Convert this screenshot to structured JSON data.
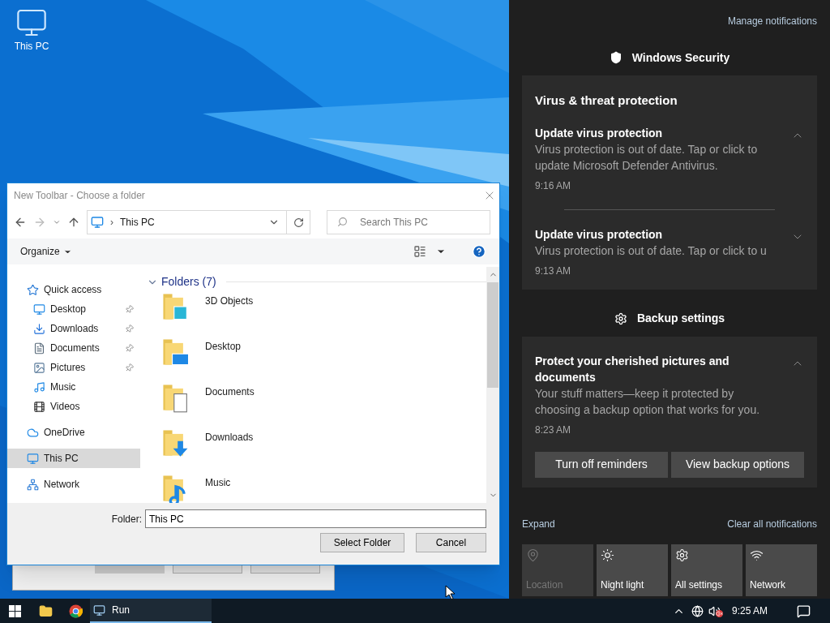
{
  "desktop": {
    "icons": [
      {
        "label": "This PC"
      }
    ]
  },
  "run_dialog": {
    "buttons": [
      {
        "disabled": true
      },
      {
        "disabled": false
      },
      {
        "disabled": false
      }
    ]
  },
  "dialog": {
    "title": "New Toolbar - Choose a folder",
    "address_separator": "›",
    "address": "This PC",
    "search": {
      "placeholder": "Search This PC"
    },
    "organize": "Organize",
    "nav": [
      {
        "label": "Quick access",
        "selected": false,
        "children": [
          {
            "label": "Desktop",
            "pinned": true,
            "selected": false
          },
          {
            "label": "Downloads",
            "pinned": true,
            "selected": false
          },
          {
            "label": "Documents",
            "pinned": true,
            "selected": false
          },
          {
            "label": "Pictures",
            "pinned": true,
            "selected": false
          },
          {
            "label": "Music",
            "pinned": false,
            "selected": false
          },
          {
            "label": "Videos",
            "pinned": false,
            "selected": false
          }
        ]
      },
      {
        "label": "OneDrive",
        "selected": false
      },
      {
        "label": "This PC",
        "selected": true
      },
      {
        "label": "Network",
        "selected": false
      }
    ],
    "group": {
      "label": "Folders (7)",
      "expanded": true
    },
    "folders": [
      "3D Objects",
      "Desktop",
      "Documents",
      "Downloads",
      "Music"
    ],
    "folder_label": "Folder:",
    "folder_value": "This PC",
    "buttons": [
      "Select Folder",
      "Cancel"
    ]
  },
  "action_center": {
    "manage": "Manage notifications",
    "groups": [
      {
        "app": "Windows Security",
        "kind": "security",
        "title": "Virus & threat protection",
        "notifications": [
          {
            "title": "Update virus protection",
            "body": "Virus protection is out of date. Tap or click to update Microsoft Defender Antivirus.",
            "time": "9:16 AM",
            "expanded": true
          },
          {
            "title": "Update virus protection",
            "body": "Virus protection is out of date. Tap or click to u",
            "time": "9:13 AM",
            "expanded": false
          }
        ]
      },
      {
        "app": "Backup settings",
        "kind": "settings",
        "notifications": [
          {
            "title": "Protect your cherished pictures and documents",
            "body": "Your stuff matters—keep it protected by choosing a backup option that works for you.",
            "time": "8:23 AM",
            "expanded": true,
            "actions": [
              "Turn off reminders",
              "View backup options"
            ]
          }
        ]
      }
    ],
    "expand": "Expand",
    "clear": "Clear all notifications",
    "tiles": [
      {
        "label": "Location",
        "disabled": true
      },
      {
        "label": "Night light",
        "disabled": false
      },
      {
        "label": "All settings",
        "disabled": false
      },
      {
        "label": "Network",
        "disabled": false
      }
    ]
  },
  "taskbar": {
    "items": [
      {
        "label": "Run",
        "active": true
      }
    ],
    "time": "9:25 AM",
    "volume_muted": true
  }
}
